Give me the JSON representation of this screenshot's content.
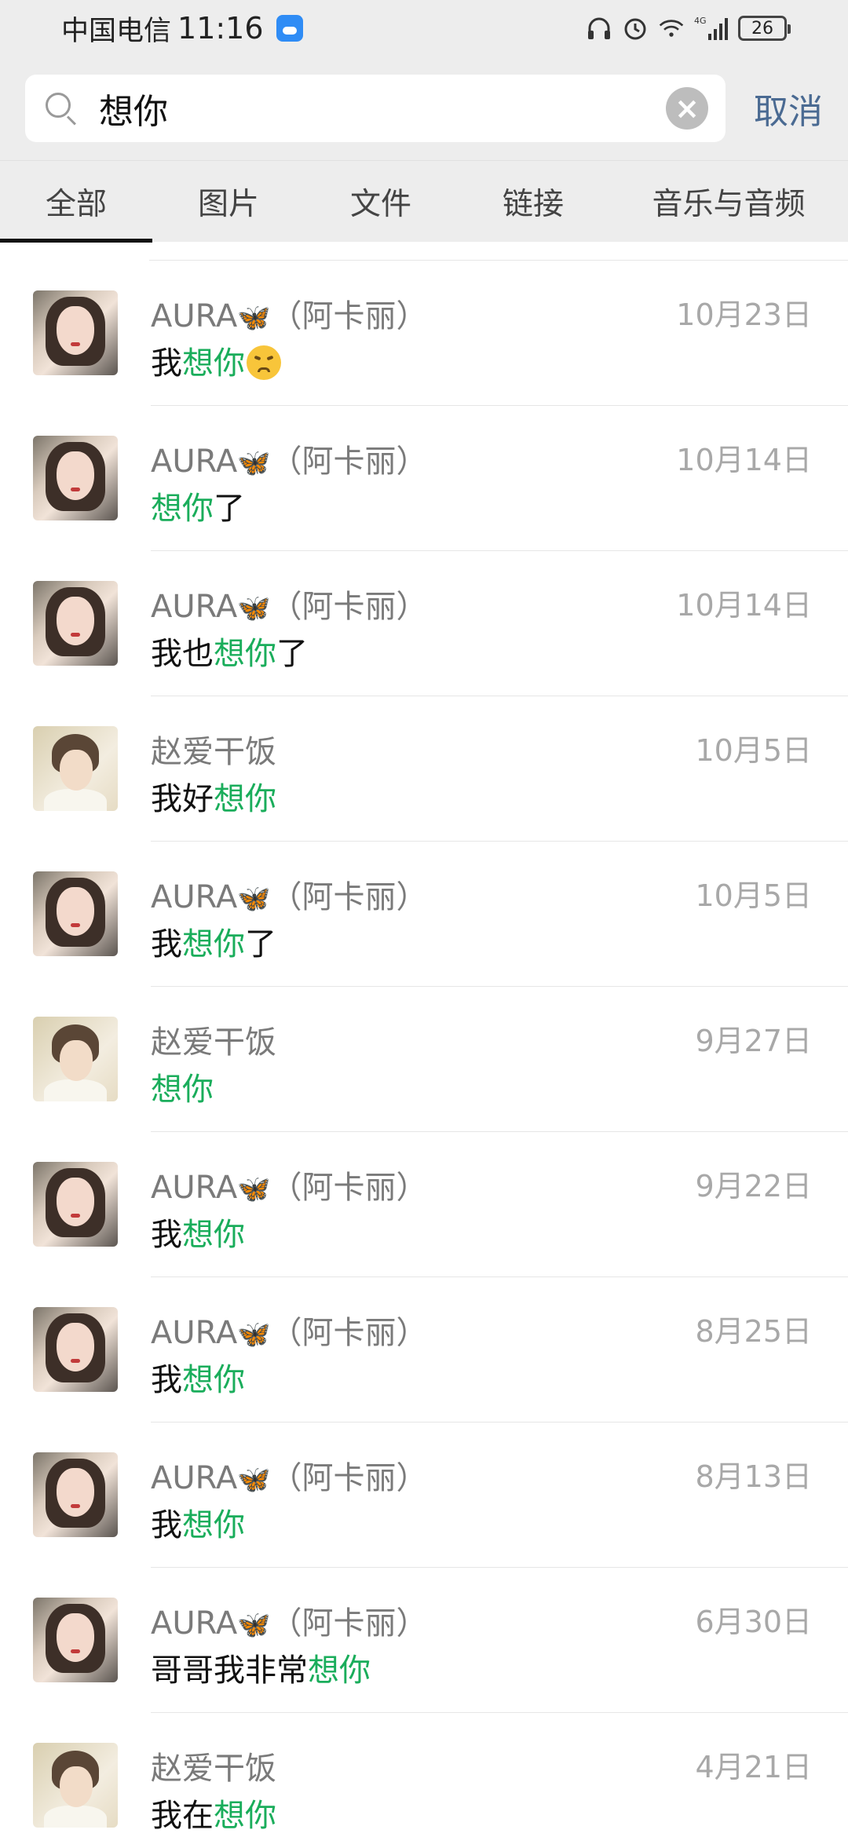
{
  "status_bar": {
    "carrier": "中国电信",
    "time": "11:16",
    "network": "4G",
    "battery": "26"
  },
  "search": {
    "query": "想你",
    "cancel": "取消"
  },
  "tabs": [
    "全部",
    "图片",
    "文件",
    "链接",
    "音乐与音频"
  ],
  "active_tab": "全部",
  "results": [
    {
      "name": "AURA",
      "suffix": "（阿卡丽）",
      "date": "10月23日",
      "pre": "我",
      "hl": "想你",
      "post": "",
      "avatar": "aura",
      "emoji": "pensive-face"
    },
    {
      "name": "AURA",
      "suffix": "（阿卡丽）",
      "date": "10月14日",
      "pre": "",
      "hl": "想你",
      "post": "了",
      "avatar": "aura"
    },
    {
      "name": "AURA",
      "suffix": "（阿卡丽）",
      "date": "10月14日",
      "pre": "我也",
      "hl": "想你",
      "post": "了",
      "avatar": "aura"
    },
    {
      "name": "赵爱干饭",
      "suffix": "",
      "date": "10月5日",
      "pre": "我好",
      "hl": "想你",
      "post": "",
      "avatar": "zhao"
    },
    {
      "name": "AURA",
      "suffix": "（阿卡丽）",
      "date": "10月5日",
      "pre": "我",
      "hl": "想你",
      "post": "了",
      "avatar": "aura"
    },
    {
      "name": "赵爱干饭",
      "suffix": "",
      "date": "9月27日",
      "pre": "",
      "hl": "想你",
      "post": "",
      "avatar": "zhao"
    },
    {
      "name": "AURA",
      "suffix": "（阿卡丽）",
      "date": "9月22日",
      "pre": "我",
      "hl": "想你",
      "post": "",
      "avatar": "aura"
    },
    {
      "name": "AURA",
      "suffix": "（阿卡丽）",
      "date": "8月25日",
      "pre": "我",
      "hl": "想你",
      "post": "",
      "avatar": "aura"
    },
    {
      "name": "AURA",
      "suffix": "（阿卡丽）",
      "date": "8月13日",
      "pre": "我",
      "hl": "想你",
      "post": "",
      "avatar": "aura"
    },
    {
      "name": "AURA",
      "suffix": "（阿卡丽）",
      "date": "6月30日",
      "pre": "哥哥我非常",
      "hl": "想你",
      "post": "",
      "avatar": "aura"
    },
    {
      "name": "赵爱干饭",
      "suffix": "",
      "date": "4月21日",
      "pre": "我在",
      "hl": "想你",
      "post": "",
      "avatar": "zhao"
    }
  ],
  "colors": {
    "highlight": "#1aad5b",
    "cancel": "#4a6a92",
    "header_bg": "#ededed"
  },
  "icons": {
    "search": "search-icon",
    "clear": "clear-icon",
    "butterfly": "butterfly-emoji"
  }
}
